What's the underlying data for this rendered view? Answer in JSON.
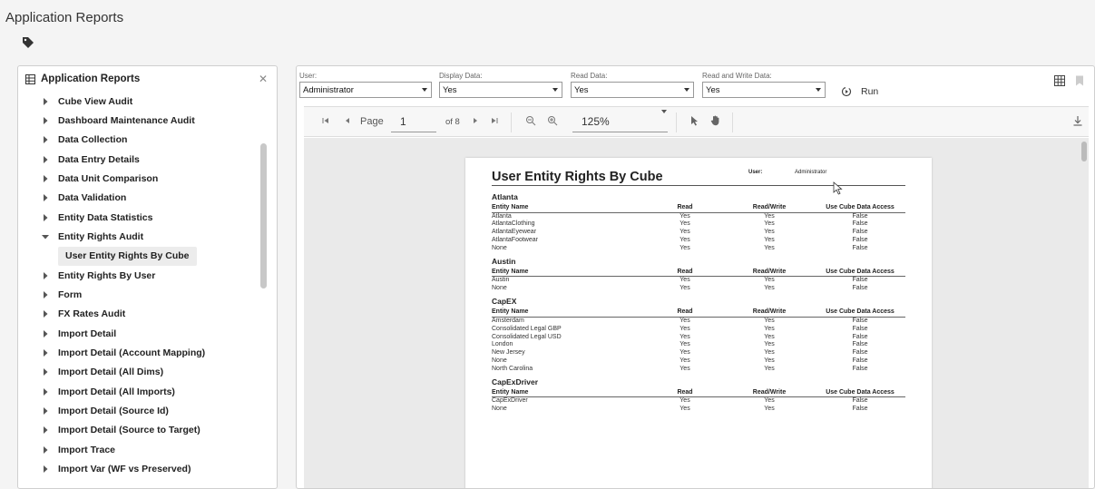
{
  "app": {
    "title": "Application Reports"
  },
  "left_panel": {
    "title": "Application Reports",
    "items": [
      {
        "label": "Cube View Audit",
        "state": "collapsed"
      },
      {
        "label": "Dashboard Maintenance Audit",
        "state": "collapsed"
      },
      {
        "label": "Data Collection",
        "state": "collapsed"
      },
      {
        "label": "Data Entry Details",
        "state": "collapsed"
      },
      {
        "label": "Data Unit Comparison",
        "state": "collapsed"
      },
      {
        "label": "Data Validation",
        "state": "collapsed"
      },
      {
        "label": "Entity Data Statistics",
        "state": "collapsed"
      },
      {
        "label": "Entity Rights Audit",
        "state": "expanded"
      },
      {
        "label": "User Entity Rights By Cube",
        "state": "selected-child"
      },
      {
        "label": "Entity Rights By User",
        "state": "collapsed"
      },
      {
        "label": "Form",
        "state": "collapsed"
      },
      {
        "label": "FX Rates Audit",
        "state": "collapsed"
      },
      {
        "label": "Import Detail",
        "state": "collapsed"
      },
      {
        "label": "Import Detail (Account Mapping)",
        "state": "collapsed"
      },
      {
        "label": "Import Detail (All Dims)",
        "state": "collapsed"
      },
      {
        "label": "Import Detail (All Imports)",
        "state": "collapsed"
      },
      {
        "label": "Import Detail (Source Id)",
        "state": "collapsed"
      },
      {
        "label": "Import Detail (Source to Target)",
        "state": "collapsed"
      },
      {
        "label": "Import Trace",
        "state": "collapsed"
      },
      {
        "label": "Import Var (WF vs Preserved)",
        "state": "collapsed"
      }
    ]
  },
  "params": {
    "user": {
      "label": "User:",
      "value": "Administrator"
    },
    "display": {
      "label": "Display Data:",
      "value": "Yes"
    },
    "read": {
      "label": "Read Data:",
      "value": "Yes"
    },
    "readwrite": {
      "label": "Read and Write Data:",
      "value": "Yes"
    },
    "run_label": "Run"
  },
  "toolbar": {
    "page_label": "Page",
    "page_value": "1",
    "of_pages": "of 8",
    "zoom": "125%"
  },
  "report": {
    "title": "User Entity Rights By Cube",
    "user_label": "User:",
    "user_value": "Administrator",
    "columns": [
      "Entity Name",
      "Read",
      "Read/Write",
      "Use Cube Data Access"
    ],
    "groups": [
      {
        "name": "Atlanta",
        "rows": [
          [
            "Atlanta",
            "Yes",
            "Yes",
            "False"
          ],
          [
            "AtlantaClothing",
            "Yes",
            "Yes",
            "False"
          ],
          [
            "AtlantaEyewear",
            "Yes",
            "Yes",
            "False"
          ],
          [
            "AtlantaFootwear",
            "Yes",
            "Yes",
            "False"
          ],
          [
            "None",
            "Yes",
            "Yes",
            "False"
          ]
        ]
      },
      {
        "name": "Austin",
        "rows": [
          [
            "Austin",
            "Yes",
            "Yes",
            "False"
          ],
          [
            "None",
            "Yes",
            "Yes",
            "False"
          ]
        ]
      },
      {
        "name": "CapEX",
        "rows": [
          [
            "Amsterdam",
            "Yes",
            "Yes",
            "False"
          ],
          [
            "Consolidated Legal GBP",
            "Yes",
            "Yes",
            "False"
          ],
          [
            "Consolidated Legal USD",
            "Yes",
            "Yes",
            "False"
          ],
          [
            "London",
            "Yes",
            "Yes",
            "False"
          ],
          [
            "New Jersey",
            "Yes",
            "Yes",
            "False"
          ],
          [
            "None",
            "Yes",
            "Yes",
            "False"
          ],
          [
            "North Carolina",
            "Yes",
            "Yes",
            "False"
          ]
        ]
      },
      {
        "name": "CapExDriver",
        "rows": [
          [
            "CapExDriver",
            "Yes",
            "Yes",
            "False"
          ],
          [
            "None",
            "Yes",
            "Yes",
            "False"
          ]
        ]
      }
    ]
  }
}
